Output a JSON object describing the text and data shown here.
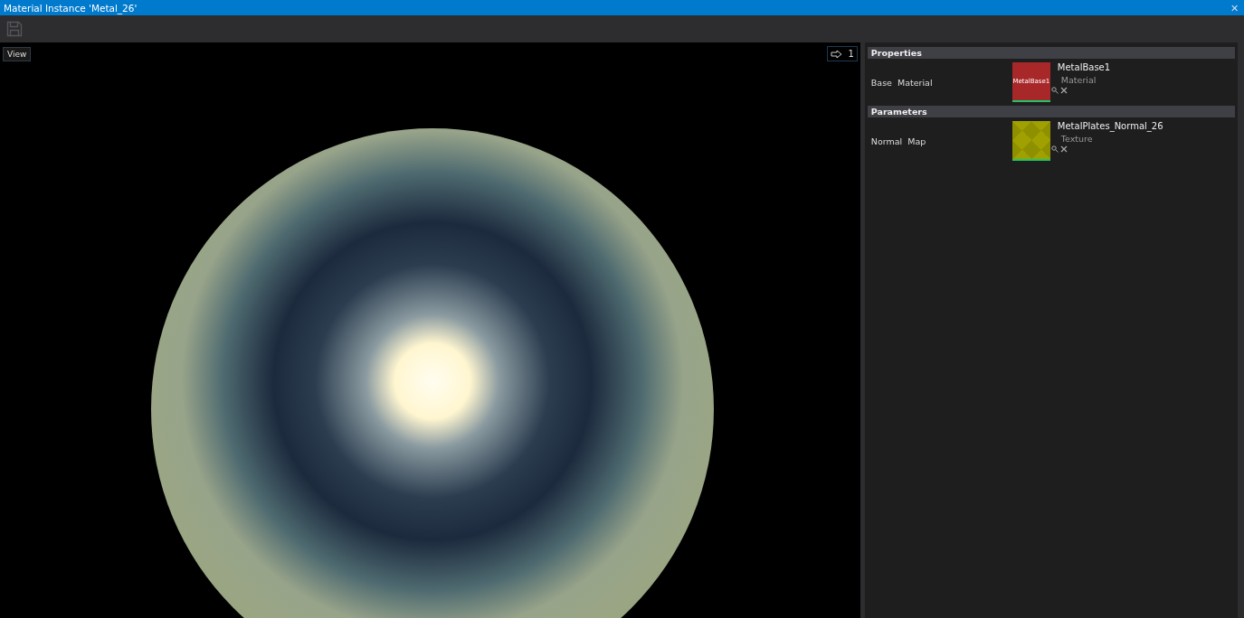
{
  "window": {
    "title": "Material Instance 'Metal_26'",
    "close": "✕"
  },
  "viewport": {
    "view_button": "View",
    "camera_speed": "1"
  },
  "sections": [
    {
      "title": "Properties",
      "rows": [
        {
          "label": "Base  Material",
          "asset": {
            "kind": "material",
            "name": "MetalBase1",
            "type": "Material",
            "thumbnail_text": "MetalBase1"
          }
        }
      ]
    },
    {
      "title": "Parameters",
      "rows": [
        {
          "label": "Normal  Map",
          "asset": {
            "kind": "texture",
            "name": "MetalPlates_Normal_26",
            "type": "Texture"
          }
        }
      ]
    }
  ]
}
